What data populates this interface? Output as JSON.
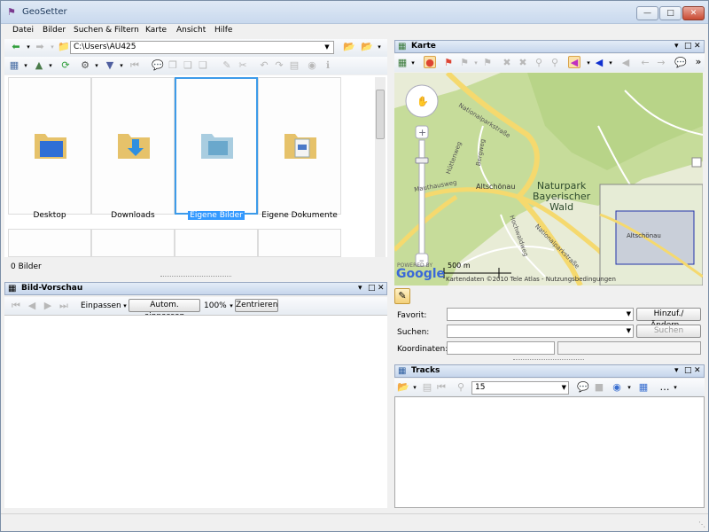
{
  "window": {
    "title": "GeoSetter"
  },
  "menu": [
    {
      "label": "Datei"
    },
    {
      "label": "Bilder"
    },
    {
      "label": "Suchen & Filtern"
    },
    {
      "label": "Karte"
    },
    {
      "label": "Ansicht"
    },
    {
      "label": "Hilfe"
    }
  ],
  "address": {
    "path": "C:\\Users\\AU425"
  },
  "folders": [
    {
      "label": "Desktop",
      "icon": "desktop-folder-icon"
    },
    {
      "label": "Downloads",
      "icon": "downloads-folder-icon"
    },
    {
      "label": "Eigene Bilder",
      "icon": "pictures-folder-icon",
      "selected": true
    },
    {
      "label": "Eigene Dokumente",
      "icon": "documents-folder-icon"
    }
  ],
  "browser_status": "0 Bilder",
  "preview": {
    "title": "Bild-Vorschau",
    "fit_label": "Einpassen",
    "auto_fit_label": "Autom. einpassen",
    "zoom": "100%",
    "center_label": "Zentrieren"
  },
  "map_panel": {
    "title": "Karte",
    "labels": {
      "region": "Naturpark\nBayerischer\nWald",
      "village": "Altschönau",
      "road1": "Nationalparkstraße",
      "road2": "Nationalparkstraße",
      "road3": "Hüttenweg",
      "road4": "Bergweg",
      "road5": "Hochwaldweg",
      "road6": "Mauthausweg",
      "overview_village": "Altschönau"
    },
    "scale": "500 m",
    "copyright": "Kartendaten ©2010 Tele Atlas - Nutzungsbedingungen",
    "brand": "Google",
    "powered": "POWERED BY"
  },
  "location": {
    "favorit_label": "Favorit:",
    "suchen_label": "Suchen:",
    "koordinaten_label": "Koordinaten:",
    "add_change_label": "Hinzuf./Ändern...",
    "search_button_label": "Suchen"
  },
  "tracks": {
    "title": "Tracks",
    "value": "15"
  },
  "colors": {
    "accent": "#3399ff",
    "map_green": "#c6dc9a",
    "road_yellow": "#f5d96e"
  }
}
